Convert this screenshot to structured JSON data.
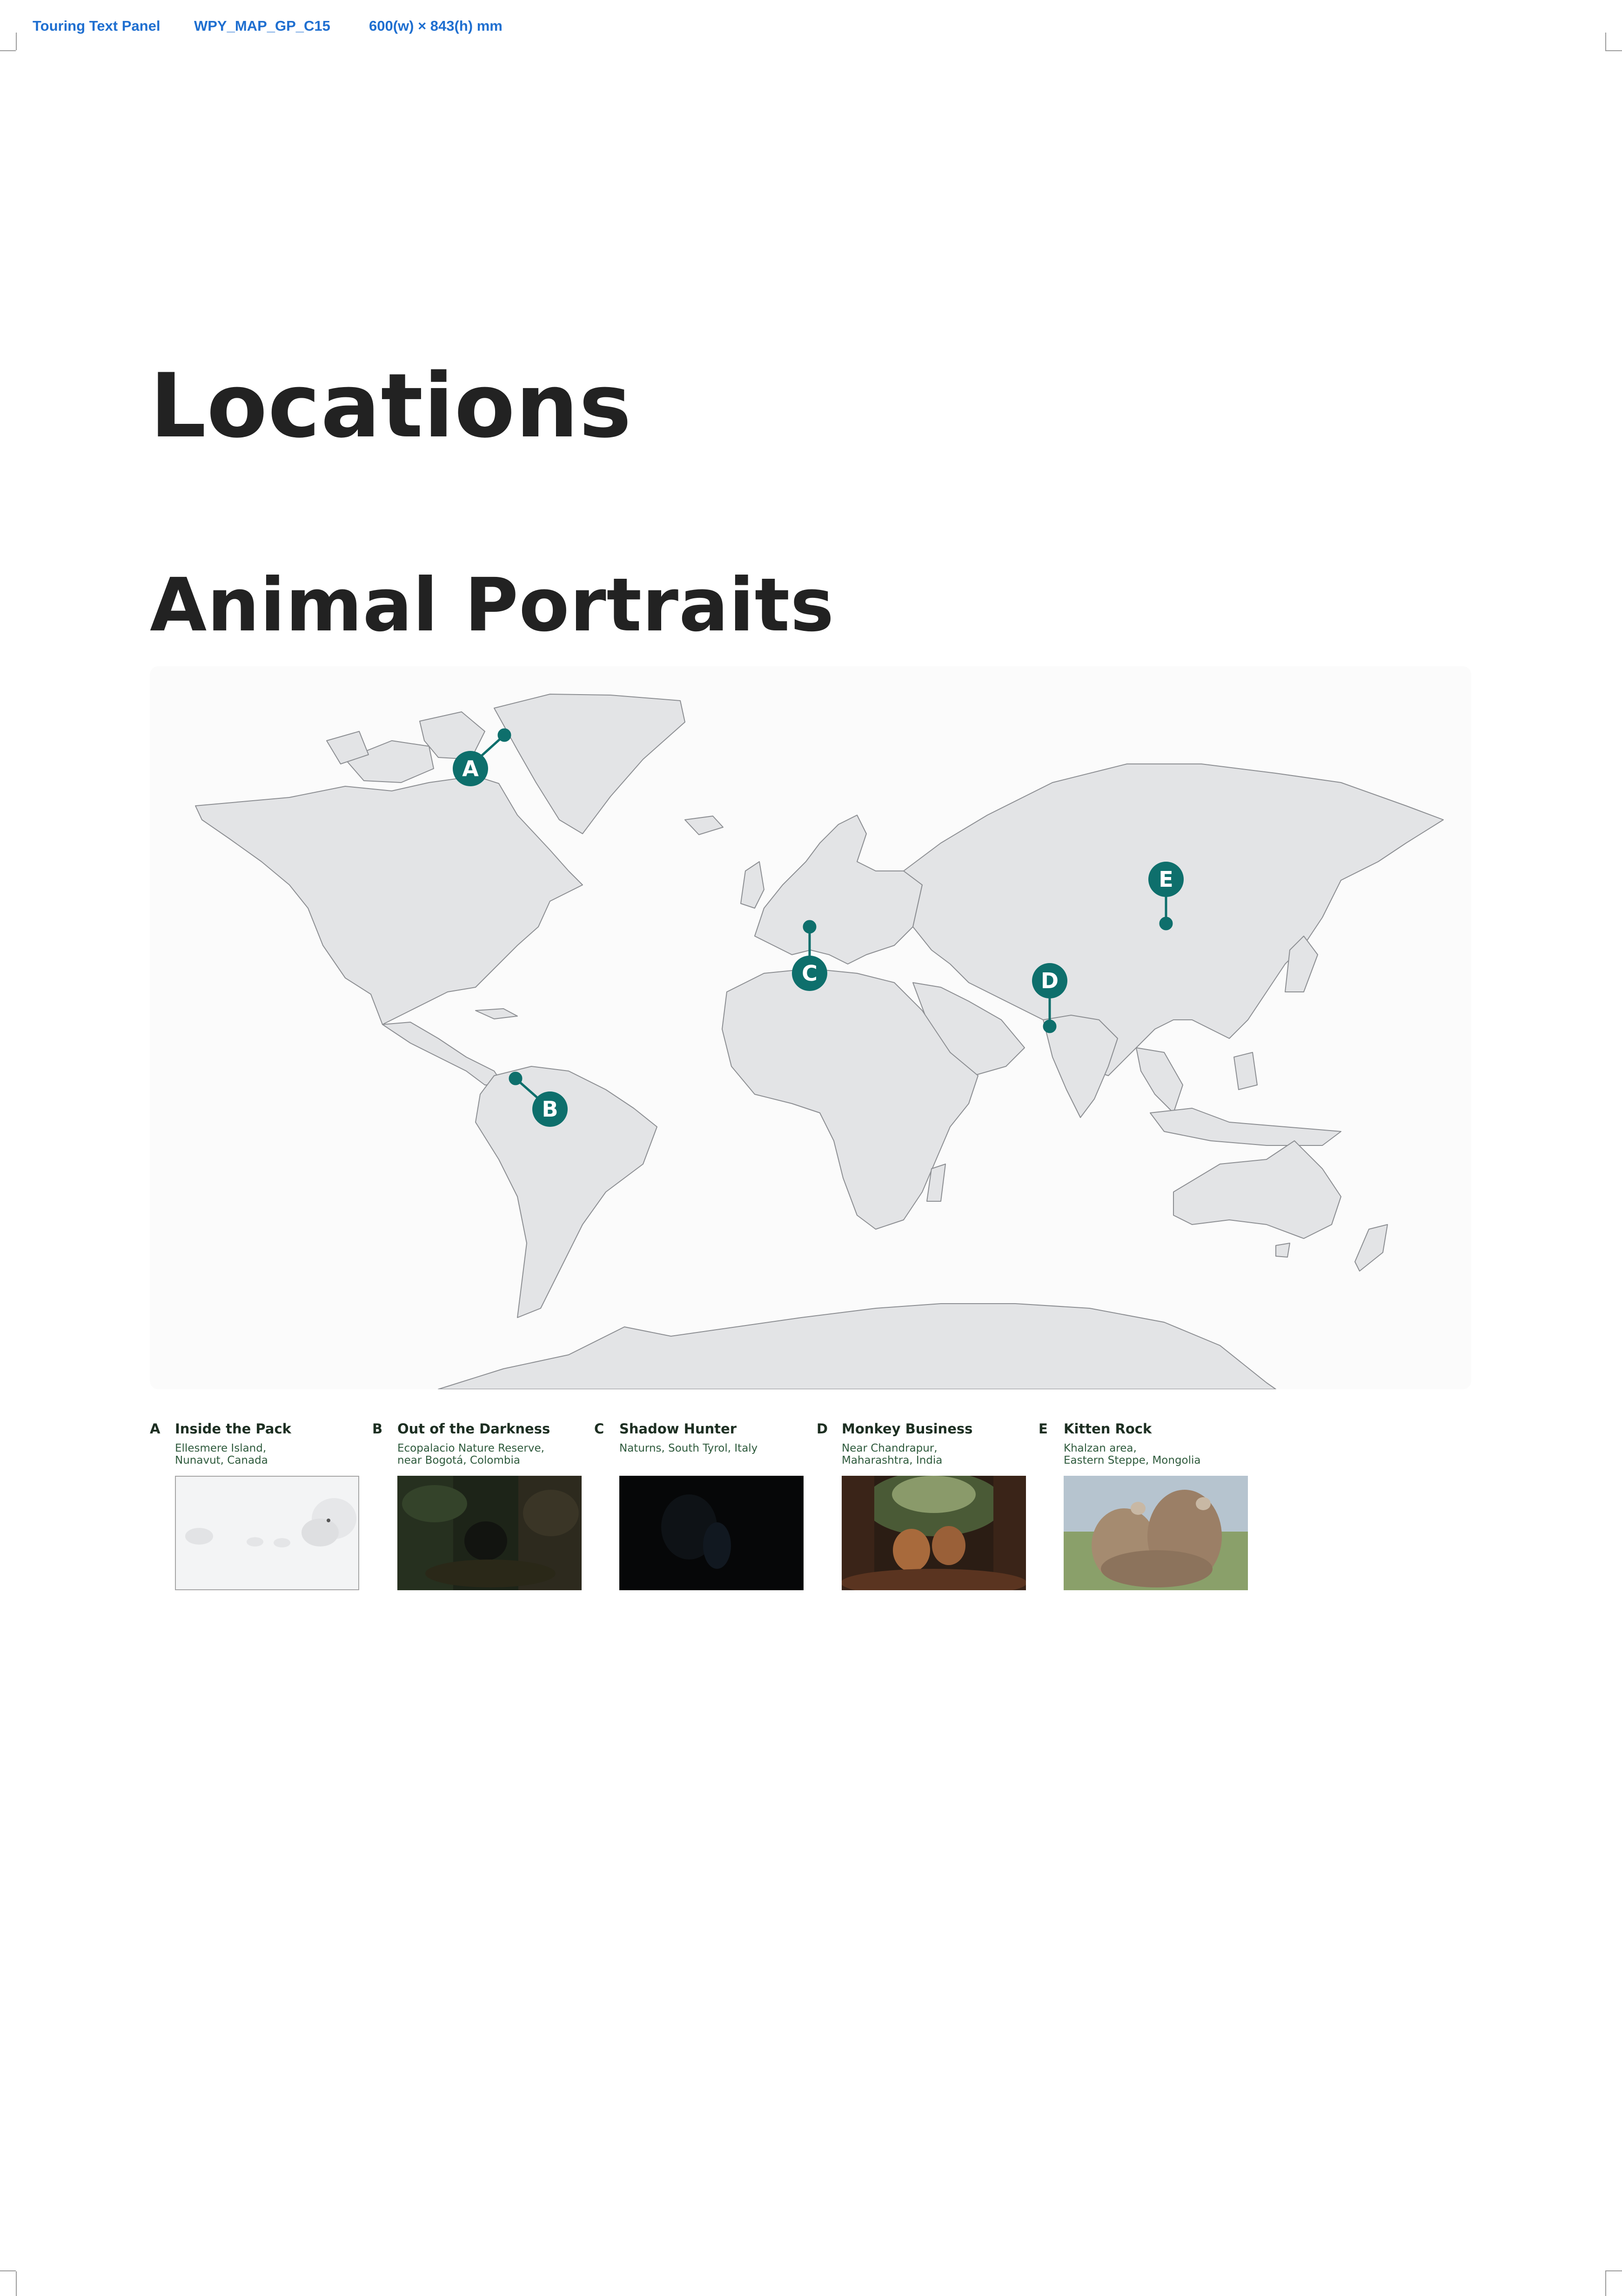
{
  "slug": {
    "panel": "Touring Text Panel",
    "code": "WPY_MAP_GP_C15",
    "size": "600(w) × 843(h) mm",
    "color": "#1f6fd0"
  },
  "heading": "Locations",
  "section_title": "Animal Portraits",
  "map": {
    "land_color": "#e3e4e6",
    "marker_color": "#0e6f6c",
    "markers": [
      {
        "letter": "A"
      },
      {
        "letter": "B"
      },
      {
        "letter": "C"
      },
      {
        "letter": "D"
      },
      {
        "letter": "E"
      }
    ]
  },
  "captions": [
    {
      "letter": "A",
      "title": "Inside the Pack",
      "location_line1": "Ellesmere Island,",
      "location_line2": "Nunavut, Canada",
      "image": "arctic-wolves-photo"
    },
    {
      "letter": "B",
      "title": "Out of the Darkness",
      "location_line1": "Ecopalacio Nature Reserve,",
      "location_line2": "near Bogotá, Colombia",
      "image": "forest-animal-photo"
    },
    {
      "letter": "C",
      "title": "Shadow Hunter",
      "location_line1": "Naturns, South Tyrol, Italy",
      "location_line2": "",
      "image": "dark-night-photo"
    },
    {
      "letter": "D",
      "title": "Monkey Business",
      "location_line1": "Near Chandrapur,",
      "location_line2": "Maharashtra, India",
      "image": "langur-monkeys-photo"
    },
    {
      "letter": "E",
      "title": "Kitten Rock",
      "location_line1": "Khalzan area,",
      "location_line2": "Eastern Steppe, Mongolia",
      "image": "manul-kittens-photo"
    }
  ]
}
